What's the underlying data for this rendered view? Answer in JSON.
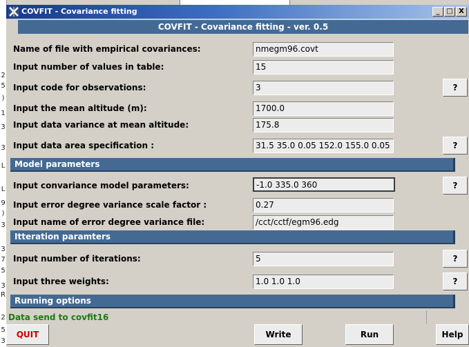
{
  "window": {
    "title": "COVFIT - Covariance fitting",
    "minimize": "_",
    "maximize": "□",
    "close": "X"
  },
  "banner": "COVFIT - Covariance fitting - ver. 0.5",
  "rows": {
    "empirical_file": {
      "label": "Name of file with empirical covariances:",
      "value": "nmegm96.covt"
    },
    "num_values": {
      "label": "Input number of values in table:",
      "value": "15"
    },
    "obs_code": {
      "label": "Input code for observations:",
      "value": "3",
      "help": "?"
    },
    "mean_altitude": {
      "label": "Input the mean altitude (m):",
      "value": "1700.0"
    },
    "data_variance": {
      "label": "Input data variance at mean altitude:",
      "value": "175.8"
    },
    "area_spec": {
      "label": "Input data area specification :",
      "value": "31.5 35.0 0.05 152.0 155.0 0.05",
      "help": "?"
    },
    "model_params": {
      "label": "Input convariance model parameters:",
      "value": "-1.0 335.0 360",
      "help": "?"
    },
    "scale_factor": {
      "label": "Input error degree variance scale factor :",
      "value": "0.27"
    },
    "edv_file": {
      "label": "Input name of error degree variance file:",
      "value": "/cct/cctf/egm96.edg"
    },
    "iterations": {
      "label": "Input number of iterations:",
      "value": "5",
      "help": "?"
    },
    "weights": {
      "label": "Input three weights:",
      "value": "1.0 1.0 1.0",
      "help": "?"
    }
  },
  "sections": {
    "model": "Model parameters",
    "iteration": "Itteration paramters",
    "running": "Running options"
  },
  "status": "Data send to covfit16",
  "buttons": {
    "quit": "QUIT",
    "write": "Write",
    "run": "Run",
    "help": "Help"
  },
  "background_chars": [
    "2",
    "5",
    ")",
    "L",
    "1",
    "3",
    "3",
    "L",
    "9",
    ")",
    "3",
    "3",
    "7",
    "5",
    "3",
    "R",
    "2",
    "5",
    "3"
  ],
  "colors": {
    "banner": "#446a94",
    "status_text": "#1a7d12",
    "quit_text": "#cc0000"
  }
}
